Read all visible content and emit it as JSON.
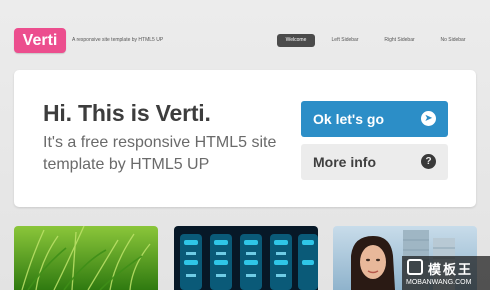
{
  "header": {
    "logo_text": "Verti",
    "tagline": "A responsive site template by HTML5 UP",
    "nav": [
      {
        "label": "Welcome",
        "active": true
      },
      {
        "label": "Left Sidebar",
        "active": false
      },
      {
        "label": "Right Sidebar",
        "active": false
      },
      {
        "label": "No Sidebar",
        "active": false
      }
    ]
  },
  "banner": {
    "title": "Hi. This is Verti.",
    "subtitle": "It's a free responsive HTML5 site template by HTML5 UP",
    "primary_button": {
      "label": "Ok let's go",
      "icon": "arrow-right-icon"
    },
    "secondary_button": {
      "label": "More info",
      "icon": "question-icon"
    }
  },
  "thumbnails": [
    {
      "subject": "green grass"
    },
    {
      "subject": "blue cylinders"
    },
    {
      "subject": "woman portrait"
    }
  ],
  "watermark": {
    "cn_text": "模板王",
    "url": "MOBANWANG.COM"
  },
  "colors": {
    "logo": "#ec4e8e",
    "primary": "#2c8ec7",
    "nav_active": "#4b4b4b",
    "page_bg": "#e8e8e8"
  }
}
